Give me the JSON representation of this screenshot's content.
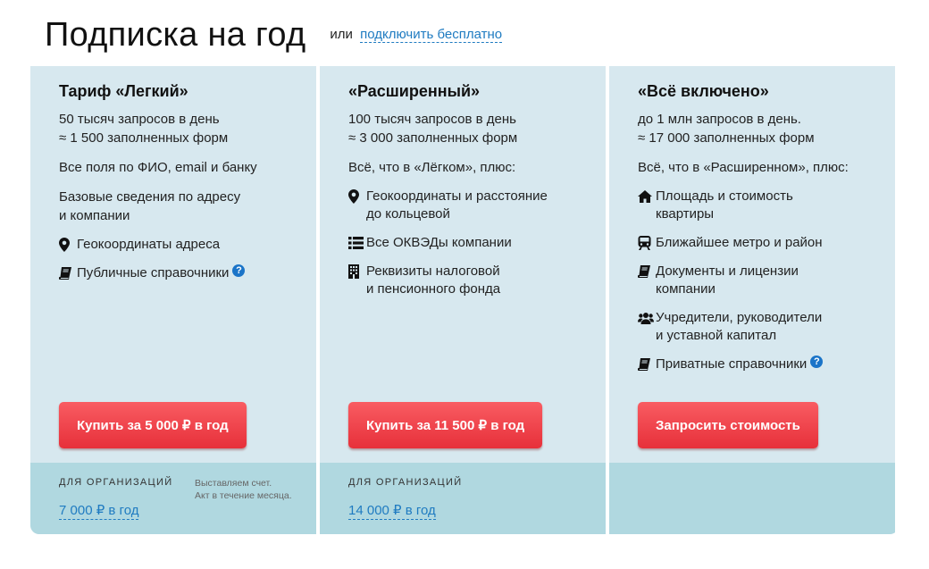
{
  "header": {
    "title": "Подписка на год",
    "alt_prefix": "или",
    "alt_link": "подключить бесплатно"
  },
  "plans": [
    {
      "title": "Тариф «Легкий»",
      "limits": [
        "50 тысяч запросов в день",
        "≈ 1 500 заполненных форм"
      ],
      "groups": [
        "Все поля по ФИО, email и банку",
        "Базовые сведения по адресу\nи компании"
      ],
      "features": [
        {
          "icon": "map-marker-icon",
          "text": "Геокоординаты адреса"
        },
        {
          "icon": "book-icon",
          "text": "Публичные справочники",
          "help": "?"
        }
      ],
      "button": "Купить за 5 000 ₽ в год",
      "footer": {
        "label": "ДЛЯ ОРГАНИЗАЦИЙ",
        "note_line1": "Выставляем счет.",
        "note_line2": "Акт в течение месяца.",
        "price": "7 000 ₽ в год"
      }
    },
    {
      "title": "«Расширенный»",
      "limits": [
        "100 тысяч запросов в день",
        "≈ 3 000 заполненных форм"
      ],
      "groups": [
        "Всё, что в «Лёгком», плюс:"
      ],
      "features": [
        {
          "icon": "map-marker-icon",
          "text": "Геокоординаты и расстояние\nдо кольцевой"
        },
        {
          "icon": "list-icon",
          "text": "Все ОКВЭДы компании"
        },
        {
          "icon": "building-icon",
          "text": "Реквизиты налоговой\nи пенсионного фонда"
        }
      ],
      "button": "Купить за 11 500 ₽ в год",
      "footer": {
        "label": "ДЛЯ ОРГАНИЗАЦИЙ",
        "price": "14 000 ₽ в год"
      }
    },
    {
      "title": "«Всё включено»",
      "limits": [
        "до 1 млн запросов в день.",
        "≈ 17 000 заполненных форм"
      ],
      "groups": [
        "Всё, что в «Расширенном», плюс:"
      ],
      "features": [
        {
          "icon": "home-icon",
          "text": "Площадь и стоимость\nквартиры"
        },
        {
          "icon": "train-icon",
          "text": "Ближайшее метро и район"
        },
        {
          "icon": "book-icon",
          "text": "Документы и лицензии\nкомпании"
        },
        {
          "icon": "users-icon",
          "text": "Учредители, руководители\nи уставной капитал"
        },
        {
          "icon": "book-icon",
          "text": "Приватные справочники",
          "help": "?"
        }
      ],
      "button": "Запросить стоимость"
    }
  ],
  "colors": {
    "accent": "#1f7bc1",
    "card_bg": "#d7e8ef",
    "footer_bg": "#b0d8e0",
    "button": "#ee3d44"
  }
}
